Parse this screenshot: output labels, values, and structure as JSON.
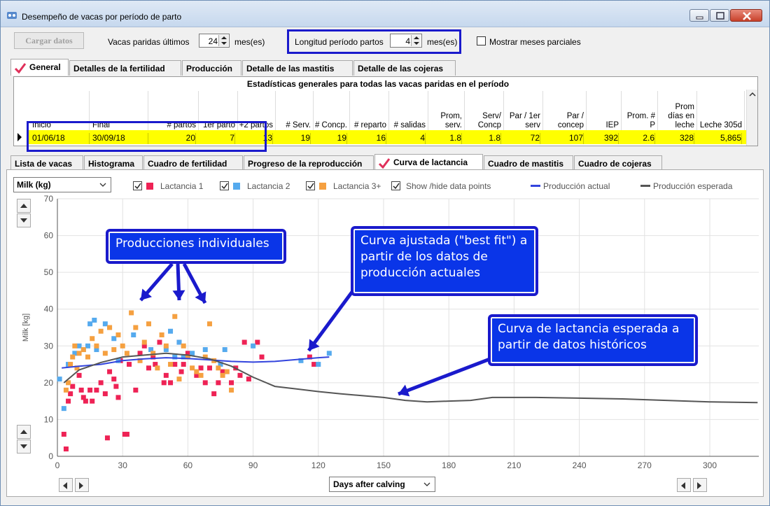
{
  "window": {
    "title": "Desempeño de vacas por período de parto"
  },
  "toolbar": {
    "load_label": "Cargar datos",
    "calved_label": "Vacas paridas últimos",
    "calved_value": "24",
    "calved_unit": "mes(es)",
    "period_label": "Longitud período partos",
    "period_value": "4",
    "period_unit": "mes(es)",
    "partial_label": "Mostrar meses parciales"
  },
  "top_tabs": [
    "General",
    "Detalles de la fertilidad",
    "Producción",
    "Detalle de las mastitis",
    "Detalle de las cojeras"
  ],
  "stats": {
    "caption": "Estadísticas generales para todas las vacas paridas en el período",
    "headers": [
      "Inicio",
      "Final",
      "# partos",
      "1er parto",
      "+2 partos",
      "# Serv.",
      "# Concp.",
      "# reparto",
      "# salidas",
      "Prom, serv.",
      "Serv/ Concp",
      "Par / 1er serv",
      "Par / concep",
      "IEP",
      "Prom. # P",
      "Prom días en leche",
      "Leche 305d"
    ],
    "row": [
      "01/06/18",
      "30/09/18",
      "20",
      "7",
      "13",
      "19",
      "19",
      "16",
      "4",
      "1.8",
      "1.8",
      "72",
      "107",
      "392",
      "2.6",
      "328",
      "5,865"
    ]
  },
  "lower_tabs": [
    "Lista de vacas",
    "Histograma",
    "Cuadro de fertilidad",
    "Progreso de la reproducción",
    "Curva de lactancia",
    "Cuadro de mastitis",
    "Cuadro de cojeras"
  ],
  "chart_controls": {
    "metric": "Milk (kg)",
    "legend": {
      "lact1": "Lactancia 1",
      "lact2": "Lactancia 2",
      "lact3": "Lactancia 3+",
      "points": "Show /hide data points",
      "actual": "Producción actual",
      "expected": "Producción esperada"
    },
    "x_axis_select": "Days after calving",
    "colors": {
      "lact1": "#ee2255",
      "lact2": "#55aaee",
      "lact3": "#f5a040",
      "actual": "#3344dd",
      "expected": "#555555"
    }
  },
  "callouts": {
    "individual": "Producciones individuales",
    "fit": "Curva ajustada (\"best fit\") a partir de los datos de producción actuales",
    "expected": "Curva de lactancia esperada a partir de datos históricos"
  },
  "chart_data": {
    "type": "scatter",
    "xlabel": "",
    "ylabel": "Milk (kg)",
    "xlim": [
      0,
      300
    ],
    "ylim": [
      0,
      70
    ],
    "x_ticks": [
      0,
      30,
      60,
      90,
      120,
      150,
      180,
      210,
      240,
      270,
      300
    ],
    "y_ticks": [
      0,
      10,
      20,
      30,
      40,
      50,
      60,
      70
    ],
    "series": [
      {
        "name": "Lactancia 1",
        "kind": "points",
        "color": "#ee2255",
        "points": [
          [
            3,
            6
          ],
          [
            4,
            2
          ],
          [
            5,
            15
          ],
          [
            6,
            17
          ],
          [
            7,
            19
          ],
          [
            10,
            22
          ],
          [
            11,
            18
          ],
          [
            12,
            16
          ],
          [
            13,
            15
          ],
          [
            15,
            18
          ],
          [
            16,
            15
          ],
          [
            18,
            18
          ],
          [
            20,
            20
          ],
          [
            22,
            17
          ],
          [
            23,
            5
          ],
          [
            24,
            23
          ],
          [
            26,
            21
          ],
          [
            27,
            19
          ],
          [
            28,
            16
          ],
          [
            29,
            26
          ],
          [
            31,
            6
          ],
          [
            32,
            6
          ],
          [
            33,
            25
          ],
          [
            36,
            18
          ],
          [
            38,
            28
          ],
          [
            40,
            30
          ],
          [
            42,
            24
          ],
          [
            44,
            27
          ],
          [
            45,
            25
          ],
          [
            47,
            31
          ],
          [
            49,
            20
          ],
          [
            50,
            22
          ],
          [
            52,
            20
          ],
          [
            54,
            25
          ],
          [
            56,
            31
          ],
          [
            57,
            23
          ],
          [
            58,
            25
          ],
          [
            60,
            28
          ],
          [
            64,
            22
          ],
          [
            66,
            24
          ],
          [
            68,
            20
          ],
          [
            70,
            24
          ],
          [
            72,
            17
          ],
          [
            74,
            20
          ],
          [
            76,
            23
          ],
          [
            80,
            20
          ],
          [
            82,
            24
          ],
          [
            84,
            22
          ],
          [
            86,
            31
          ],
          [
            88,
            21
          ],
          [
            92,
            31
          ],
          [
            94,
            27
          ],
          [
            116,
            27
          ],
          [
            118,
            25
          ]
        ]
      },
      {
        "name": "Lactancia 2",
        "kind": "points",
        "color": "#55aaee",
        "points": [
          [
            1,
            21
          ],
          [
            3,
            13
          ],
          [
            5,
            25
          ],
          [
            8,
            28
          ],
          [
            10,
            30
          ],
          [
            12,
            29
          ],
          [
            14,
            30
          ],
          [
            15,
            36
          ],
          [
            17,
            37
          ],
          [
            18,
            29
          ],
          [
            22,
            36
          ],
          [
            24,
            35
          ],
          [
            26,
            32
          ],
          [
            28,
            26
          ],
          [
            35,
            33
          ],
          [
            43,
            29
          ],
          [
            50,
            29
          ],
          [
            52,
            34
          ],
          [
            54,
            27
          ],
          [
            56,
            31
          ],
          [
            58,
            27
          ],
          [
            62,
            28
          ],
          [
            68,
            29
          ],
          [
            75,
            25
          ],
          [
            77,
            29
          ],
          [
            90,
            30
          ],
          [
            112,
            26
          ],
          [
            120,
            25
          ],
          [
            125,
            28
          ]
        ]
      },
      {
        "name": "Lactancia 3+",
        "kind": "points",
        "color": "#f5a040",
        "points": [
          [
            4,
            18
          ],
          [
            5,
            20
          ],
          [
            6,
            25
          ],
          [
            7,
            27
          ],
          [
            8,
            30
          ],
          [
            9,
            24
          ],
          [
            10,
            28
          ],
          [
            12,
            29
          ],
          [
            14,
            27
          ],
          [
            16,
            32
          ],
          [
            18,
            30
          ],
          [
            20,
            34
          ],
          [
            22,
            28
          ],
          [
            24,
            35
          ],
          [
            26,
            29
          ],
          [
            28,
            33
          ],
          [
            30,
            30
          ],
          [
            32,
            28
          ],
          [
            34,
            39
          ],
          [
            36,
            35
          ],
          [
            38,
            26
          ],
          [
            40,
            31
          ],
          [
            42,
            36
          ],
          [
            44,
            28
          ],
          [
            46,
            24
          ],
          [
            48,
            33
          ],
          [
            50,
            30
          ],
          [
            52,
            25
          ],
          [
            54,
            38
          ],
          [
            56,
            21
          ],
          [
            58,
            30
          ],
          [
            60,
            27
          ],
          [
            62,
            24
          ],
          [
            64,
            23
          ],
          [
            66,
            22
          ],
          [
            68,
            27
          ],
          [
            70,
            36
          ],
          [
            72,
            26
          ],
          [
            74,
            24
          ],
          [
            76,
            22
          ],
          [
            78,
            23
          ],
          [
            80,
            18
          ]
        ]
      },
      {
        "name": "Producción actual",
        "kind": "line",
        "color": "#3344dd",
        "points": [
          [
            2,
            24
          ],
          [
            10,
            24.5
          ],
          [
            20,
            25
          ],
          [
            30,
            26
          ],
          [
            40,
            26.5
          ],
          [
            50,
            26.8
          ],
          [
            60,
            26.6
          ],
          [
            70,
            26.2
          ],
          [
            80,
            25.8
          ],
          [
            90,
            25.6
          ],
          [
            100,
            25.8
          ],
          [
            110,
            26.3
          ],
          [
            120,
            26.8
          ],
          [
            125,
            27
          ]
        ]
      },
      {
        "name": "Producción esperada",
        "kind": "line",
        "color": "#555555",
        "points": [
          [
            3,
            20
          ],
          [
            10,
            23.5
          ],
          [
            20,
            25.5
          ],
          [
            30,
            27
          ],
          [
            40,
            27.5
          ],
          [
            50,
            28
          ],
          [
            60,
            27.5
          ],
          [
            70,
            26.5
          ],
          [
            80,
            24.5
          ],
          [
            90,
            21.5
          ],
          [
            100,
            19
          ],
          [
            110,
            18.3
          ],
          [
            120,
            17.6
          ],
          [
            130,
            17
          ],
          [
            140,
            16.5
          ],
          [
            150,
            16
          ],
          [
            160,
            15.2
          ],
          [
            170,
            14.8
          ],
          [
            180,
            15
          ],
          [
            190,
            15.2
          ],
          [
            200,
            16
          ],
          [
            210,
            16
          ],
          [
            220,
            16
          ],
          [
            240,
            15.8
          ],
          [
            260,
            15.6
          ],
          [
            280,
            15.2
          ],
          [
            300,
            14.8
          ],
          [
            322,
            14.6
          ]
        ]
      }
    ]
  }
}
